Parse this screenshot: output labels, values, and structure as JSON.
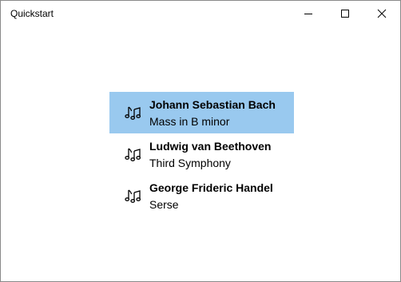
{
  "window": {
    "title": "Quickstart",
    "buttons": {
      "minimize": "minimize-icon",
      "maximize": "maximize-icon",
      "close": "close-icon"
    }
  },
  "list": {
    "selected_index": 0,
    "selection_color": "#99c9ef",
    "items": [
      {
        "composer": "Johann Sebastian Bach",
        "work": "Mass in B minor",
        "icon": "music-note-icon"
      },
      {
        "composer": "Ludwig van Beethoven",
        "work": "Third Symphony",
        "icon": "music-note-icon"
      },
      {
        "composer": "George Frideric Handel",
        "work": "Serse",
        "icon": "music-note-icon"
      }
    ]
  }
}
